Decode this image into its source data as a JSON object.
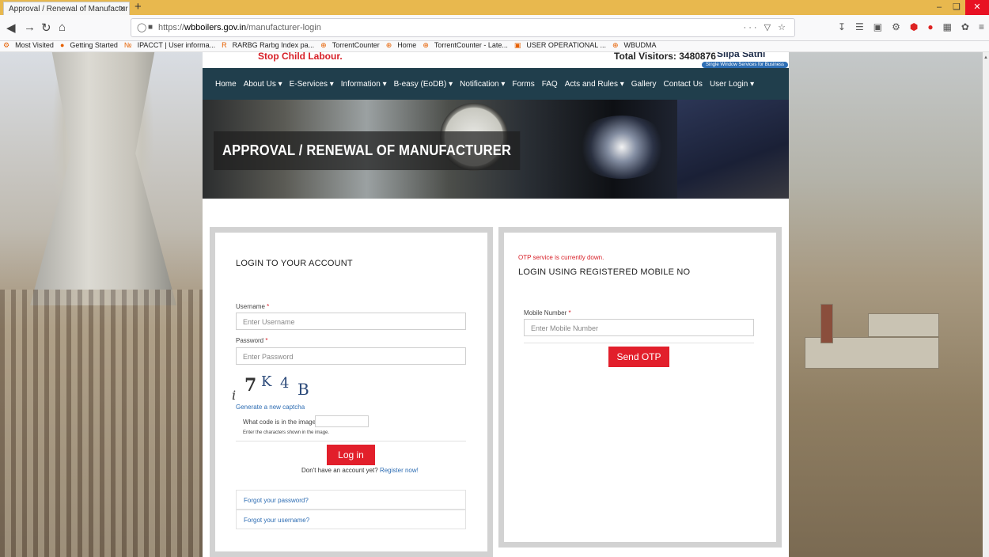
{
  "browser": {
    "tab_title": "Approval / Renewal of Manufactur",
    "tab_close": "×",
    "new_tab": "+",
    "url_prefix": "https://",
    "url_domain": "wbboilers.gov.in",
    "url_path": "/manufacturer-login",
    "url_more": "···",
    "bookmarks": [
      {
        "icon": "gear-icon",
        "label": "Most Visited"
      },
      {
        "icon": "firefox-icon",
        "label": "Getting Started"
      },
      {
        "icon": "ip-icon",
        "label": "IPACCT | User informa..."
      },
      {
        "icon": "r-icon",
        "label": "RARBG Rarbg Index pa..."
      },
      {
        "icon": "globe-icon",
        "label": "TorrentCounter"
      },
      {
        "icon": "globe-icon",
        "label": "Home"
      },
      {
        "icon": "globe-icon",
        "label": "TorrentCounter - Late..."
      },
      {
        "icon": "image-icon",
        "label": "USER OPERATIONAL ..."
      },
      {
        "icon": "globe-icon",
        "label": "WBUDMA"
      }
    ]
  },
  "site": {
    "top_left_text": "Stop Child Labour.",
    "top_visitors": "Total Visitors: 3480876",
    "top_right_text": "Silpa Sathi",
    "single_window_badge": "Single Window Services for Business",
    "menu": [
      "Home",
      "About Us ▾",
      "E-Services ▾",
      "Information ▾",
      "B-easy (EoDB) ▾",
      "Notification ▾",
      "Forms",
      "FAQ",
      "Acts and Rules ▾",
      "Gallery",
      "Contact Us",
      "User Login ▾"
    ],
    "banner_title": "APPROVAL / RENEWAL OF MANUFACTURER"
  },
  "login": {
    "title": "LOGIN TO YOUR ACCOUNT",
    "username_label": "Username",
    "username_placeholder": "Enter Username",
    "password_label": "Password",
    "password_placeholder": "Enter Password",
    "captcha_chars": [
      "i",
      "7",
      "K",
      "4",
      "B"
    ],
    "new_captcha_link": "Generate a new captcha",
    "captcha_question": "What code is in the image?",
    "captcha_help": "Enter the characters shown in the image.",
    "login_button": "Log in",
    "no_account_text": "Don't have an account yet?",
    "register_link": "Register now!",
    "forgot_password": "Forgot your password?",
    "forgot_username": "Forgot your username?",
    "required_mark": "*"
  },
  "otp": {
    "warning": "OTP service is currently down.",
    "title": "LOGIN USING REGISTERED MOBILE NO",
    "mobile_label": "Mobile Number",
    "mobile_placeholder": "Enter Mobile Number",
    "send_button": "Send OTP"
  }
}
